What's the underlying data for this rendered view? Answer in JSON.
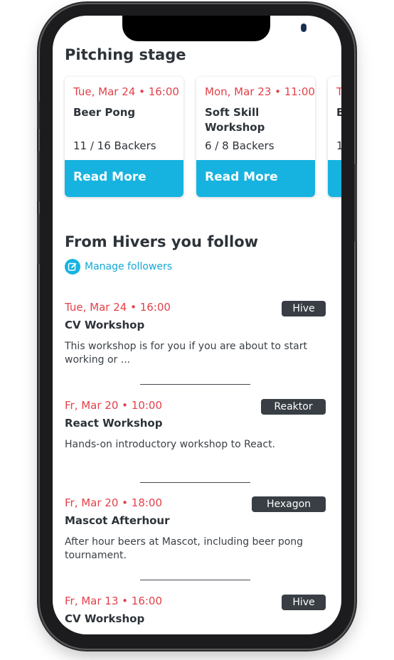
{
  "pitching": {
    "heading": "Pitching stage",
    "cards": [
      {
        "date": "Tue, Mar 24 • 16:00",
        "title": "Beer Pong",
        "backers": "11 / 16 Backers",
        "cta": "Read More"
      },
      {
        "date": "Mon, Mar 23 • 11:00",
        "title": "Soft Skill Workshop",
        "backers": "6 / 8 Backers",
        "cta": "Read More"
      },
      {
        "date": "T",
        "title": "B",
        "backers": "1",
        "cta": ""
      }
    ]
  },
  "follow": {
    "heading": "From Hivers you follow",
    "manage_label": "Manage followers",
    "manage_icon": "edit-icon",
    "items": [
      {
        "date": "Tue, Mar 24 • 16:00",
        "title": "CV Workshop",
        "description": "This workshop is for you if you are about to start working or ...",
        "badge": "Hive"
      },
      {
        "date": "Fr, Mar 20 • 10:00",
        "title": "React Workshop",
        "description": "Hands-on introductory workshop to React.",
        "badge": "Reaktor"
      },
      {
        "date": "Fr, Mar 20 • 18:00",
        "title": "Mascot Afterhour",
        "description": "After hour beers at Mascot, including beer pong tournament.",
        "badge": "Hexagon"
      },
      {
        "date": "Fr, Mar 13 • 16:00",
        "title": "CV Workshop",
        "description": "",
        "badge": "Hive"
      }
    ]
  },
  "colors": {
    "accent": "#17b3e0",
    "date": "#e3414a",
    "text": "#2d3339",
    "badge": "#383e44"
  }
}
